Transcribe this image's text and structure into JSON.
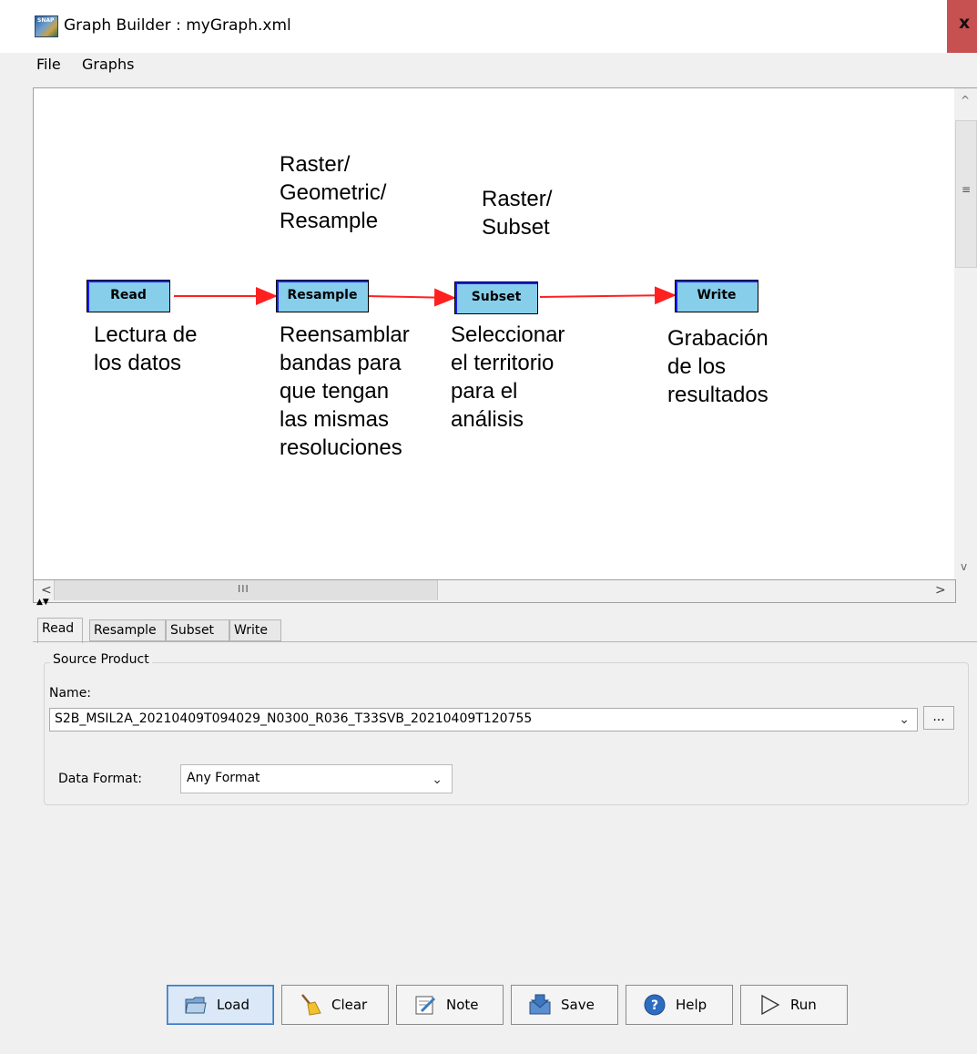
{
  "window": {
    "title": "Graph Builder : myGraph.xml",
    "app_icon_text": "SNAP",
    "close_label": "x"
  },
  "menu": {
    "file": "File",
    "graphs": "Graphs"
  },
  "graph": {
    "nodes": {
      "read": "Read",
      "resample": "Resample",
      "subset": "Subset",
      "write": "Write"
    },
    "annotations": {
      "resample_path": "Raster/\nGeometric/\nResample",
      "subset_path": "Raster/\nSubset",
      "read_desc": "Lectura de\nlos datos",
      "resample_desc": "Reensamblar\nbandas para\nque tengan\nlas mismas\nresoluciones",
      "subset_desc": "Seleccionar\nel territorio\npara el\nanálisis",
      "write_desc": "Grabación\nde los\nresultados"
    },
    "edge_color": "#ff2020",
    "node_color": "#87ceeb"
  },
  "scrollbars": {
    "up": "^",
    "down": "v",
    "grip_v": "≡",
    "left": "<",
    "right": ">",
    "grip_h": "III"
  },
  "tabs": [
    "Read",
    "Resample",
    "Subset",
    "Write"
  ],
  "active_tab": "Read",
  "source_product": {
    "group_title": "Source Product",
    "name_label": "Name:",
    "name_value": "S2B_MSIL2A_20210409T094029_N0300_R036_T33SVB_20210409T120755",
    "browse_label": "...",
    "format_label": "Data Format:",
    "format_value": "Any Format"
  },
  "buttons": {
    "load": "Load",
    "clear": "Clear",
    "note": "Note",
    "save": "Save",
    "help": "Help",
    "run": "Run"
  }
}
